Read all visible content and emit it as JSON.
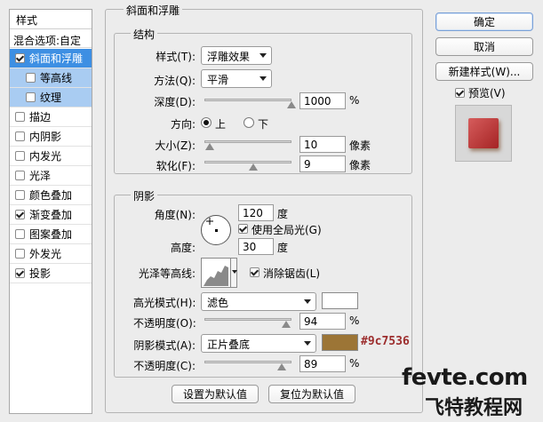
{
  "styles_panel": {
    "title": "样式",
    "blend_options": "混合选项:自定",
    "items": [
      {
        "label": "斜面和浮雕",
        "checked": true,
        "state": "selected"
      },
      {
        "label": "等高线",
        "checked": false,
        "state": "sub"
      },
      {
        "label": "纹理",
        "checked": false,
        "state": "sub"
      },
      {
        "label": "描边",
        "checked": false,
        "state": "normal"
      },
      {
        "label": "内阴影",
        "checked": false,
        "state": "normal"
      },
      {
        "label": "内发光",
        "checked": false,
        "state": "normal"
      },
      {
        "label": "光泽",
        "checked": false,
        "state": "normal"
      },
      {
        "label": "颜色叠加",
        "checked": false,
        "state": "normal"
      },
      {
        "label": "渐变叠加",
        "checked": true,
        "state": "normal"
      },
      {
        "label": "图案叠加",
        "checked": false,
        "state": "normal"
      },
      {
        "label": "外发光",
        "checked": false,
        "state": "normal"
      },
      {
        "label": "投影",
        "checked": true,
        "state": "normal"
      }
    ]
  },
  "bevel": {
    "title": "斜面和浮雕",
    "structure": {
      "title": "结构",
      "style_label": "样式(T):",
      "style_value": "浮雕效果",
      "technique_label": "方法(Q):",
      "technique_value": "平滑",
      "depth_label": "深度(D):",
      "depth_value": "1000",
      "depth_unit": "%",
      "depth_fraction": 1.0,
      "direction_label": "方向:",
      "direction_up": "上",
      "direction_down": "下",
      "direction_selected": "上",
      "size_label": "大小(Z):",
      "size_value": "10",
      "size_unit": "像素",
      "size_fraction": 0.06,
      "soften_label": "软化(F):",
      "soften_value": "9",
      "soften_unit": "像素",
      "soften_fraction": 0.56
    },
    "shading": {
      "title": "阴影",
      "angle_label": "角度(N):",
      "angle_value": "120",
      "angle_unit": "度",
      "global_light_label": "使用全局光(G)",
      "global_light_checked": true,
      "altitude_label": "高度:",
      "altitude_value": "30",
      "altitude_unit": "度",
      "gloss_contour_label": "光泽等高线:",
      "anti_alias_label": "消除锯齿(L)",
      "anti_alias_checked": true,
      "highlight_mode_label": "高光模式(H):",
      "highlight_mode_value": "滤色",
      "highlight_color": "#ffffff",
      "highlight_opacity_label": "不透明度(O):",
      "highlight_opacity_value": "94",
      "highlight_opacity_unit": "%",
      "highlight_opacity_fraction": 0.94,
      "shadow_mode_label": "阴影模式(A):",
      "shadow_mode_value": "正片叠底",
      "shadow_color": "#9c7536",
      "shadow_color_label": "#9c7536",
      "shadow_opacity_label": "不透明度(C):",
      "shadow_opacity_value": "89",
      "shadow_opacity_unit": "%",
      "shadow_opacity_fraction": 0.89
    },
    "make_default": "设置为默认值",
    "reset_default": "复位为默认值"
  },
  "actions": {
    "ok": "确定",
    "cancel": "取消",
    "new_style": "新建样式(W)...",
    "preview_label": "预览(V)",
    "preview_checked": true
  },
  "watermark": {
    "line1": "fevte.com",
    "line2": "飞特教程网"
  }
}
